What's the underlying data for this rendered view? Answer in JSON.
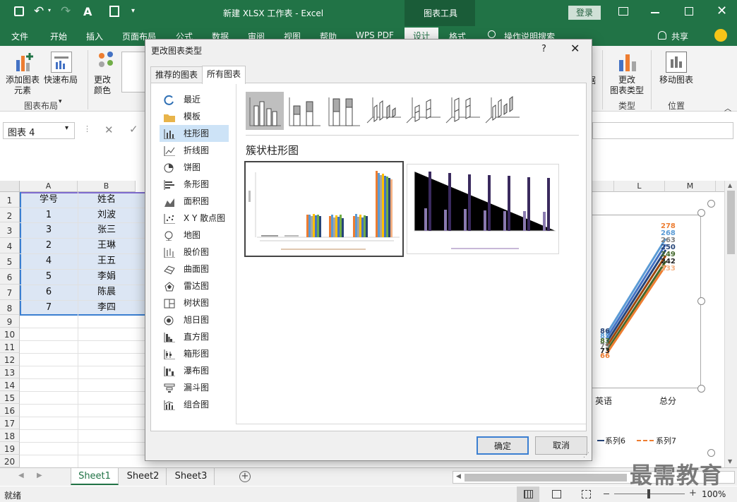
{
  "window": {
    "title": "新建 XLSX 工作表 - Excel",
    "tools_label": "图表工具",
    "login_label": "登录",
    "colors": {
      "brand": "#217346",
      "accent_bar": "#3b7fd1",
      "selection": "#dce6f4"
    }
  },
  "ribbon_tabs": [
    "文件",
    "开始",
    "插入",
    "页面布局",
    "公式",
    "数据",
    "审阅",
    "视图",
    "帮助",
    "WPS PDF",
    "设计",
    "格式"
  ],
  "tell_me": "操作说明搜索",
  "share_label": "共享",
  "ribbon": {
    "add_element": [
      "添加图表",
      "元素"
    ],
    "quick_layout": "快速布局",
    "change_color": [
      "更改",
      "颜色"
    ],
    "group_layout": "图表布局",
    "change_type": [
      "更改",
      "图表类型"
    ],
    "group_type": "类型",
    "move_chart": "移动图表",
    "group_location": "位置",
    "partial_text": "据"
  },
  "formula_bar": {
    "name_box": "图表 4"
  },
  "grid": {
    "columns": [
      "A",
      "B",
      "L",
      "M"
    ],
    "row_numbers": [
      "1",
      "2",
      "3",
      "4",
      "5",
      "6",
      "7",
      "8",
      "9",
      "10",
      "11",
      "12",
      "13",
      "14",
      "15",
      "16",
      "17",
      "18",
      "19",
      "20"
    ],
    "header": [
      "学号",
      "姓名"
    ],
    "rows": [
      [
        "1",
        "刘波"
      ],
      [
        "3",
        "张三"
      ],
      [
        "2",
        "王琳"
      ],
      [
        "4",
        "王五"
      ],
      [
        "5",
        "李娟"
      ],
      [
        "6",
        "陈晨"
      ],
      [
        "7",
        "李四"
      ]
    ]
  },
  "bg_chart": {
    "labels_high": [
      "278",
      "268",
      "263",
      "250",
      "249",
      "242",
      "233"
    ],
    "labels_low": [
      "86",
      "85",
      "83",
      "79",
      "73",
      "66"
    ],
    "xticks": [
      "英语",
      "总分"
    ],
    "legend": [
      "系列6",
      "系列7"
    ]
  },
  "sheets": [
    "Sheet1",
    "Sheet2",
    "Sheet3"
  ],
  "status": {
    "ready": "就绪",
    "zoom": "100%"
  },
  "watermark": "最需教育",
  "dialog": {
    "title": "更改图表类型",
    "help": "?",
    "tabs": [
      "推荐的图表",
      "所有图表"
    ],
    "categories": [
      "最近",
      "模板",
      "柱形图",
      "折线图",
      "饼图",
      "条形图",
      "面积图",
      "X Y 散点图",
      "地图",
      "股价图",
      "曲面图",
      "雷达图",
      "树状图",
      "旭日图",
      "直方图",
      "箱形图",
      "瀑布图",
      "漏斗图",
      "组合图"
    ],
    "selected_category": "柱形图",
    "subtype_title": "簇状柱形图",
    "ok": "确定",
    "cancel": "取消"
  }
}
